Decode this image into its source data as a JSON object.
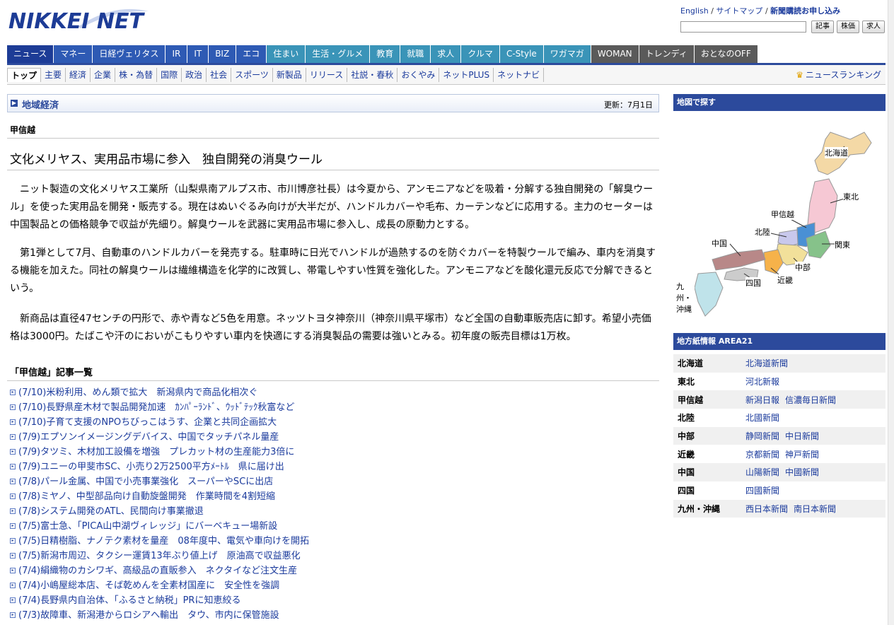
{
  "header": {
    "logo": "NIKKEI NET",
    "links": [
      "English",
      "サイトマップ",
      "新聞購読お申し込み"
    ],
    "search_placeholder": "",
    "search_buttons": [
      "記事",
      "株価",
      "求人"
    ]
  },
  "main_nav": [
    {
      "label": "ニュース",
      "color": "#1d3c96"
    },
    {
      "label": "マネー",
      "color": "#2e5ab4"
    },
    {
      "label": "日経ヴェリタス",
      "color": "#2e5ab4"
    },
    {
      "label": "IR",
      "color": "#2e5ab4"
    },
    {
      "label": "IT",
      "color": "#2e5ab4"
    },
    {
      "label": "BIZ",
      "color": "#2e5ab4"
    },
    {
      "label": "エコ",
      "color": "#2e5ab4"
    },
    {
      "label": "住まい",
      "color": "#3a94b8"
    },
    {
      "label": "生活・グルメ",
      "color": "#3a94b8"
    },
    {
      "label": "教育",
      "color": "#3a94b8"
    },
    {
      "label": "就職",
      "color": "#3a94b8"
    },
    {
      "label": "求人",
      "color": "#3a94b8"
    },
    {
      "label": "クルマ",
      "color": "#3a94b8"
    },
    {
      "label": "C-Style",
      "color": "#3a94b8"
    },
    {
      "label": "ワガマガ",
      "color": "#3a94b8"
    },
    {
      "label": "WOMAN",
      "color": "#5a5a5a"
    },
    {
      "label": "トレンディ",
      "color": "#5a5a5a"
    },
    {
      "label": "おとなのOFF",
      "color": "#5a5a5a"
    }
  ],
  "sub_nav": [
    "トップ",
    "主要",
    "経済",
    "企業",
    "株・為替",
    "国際",
    "政治",
    "社会",
    "スポーツ",
    "新製品",
    "リリース",
    "社説・春秋",
    "おくやみ",
    "ネットPLUS",
    "ネットナビ"
  ],
  "ranking_link": "ニュースランキング",
  "section": {
    "title": "地域経済",
    "updated": "更新：7月1日"
  },
  "region_label": "甲信越",
  "article": {
    "headline": "文化メリヤス、実用品市場に参入　独自開発の消臭ウール",
    "paragraphs": [
      "ニット製造の文化メリヤス工業所（山梨県南アルプス市、市川博彦社長）は今夏から、アンモニアなどを吸着・分解する独自開発の「解臭ウール」を使った実用品を開発・販売する。現在はぬいぐるみ向けが大半だが、ハンドルカバーや毛布、カーテンなどに応用する。主力のセーターは中国製品との価格競争で収益が先細り。解臭ウールを武器に実用品市場に参入し、成長の原動力とする。",
      "第1弾として7月、自動車のハンドルカバーを発売する。駐車時に日光でハンドルが過熱するのを防ぐカバーを特製ウールで編み、車内を消臭する機能を加えた。同社の解臭ウールは繊維構造を化学的に改質し、帯電しやすい性質を強化した。アンモニアなどを酸化還元反応で分解できるという。",
      "新商品は直径47センチの円形で、赤や青など5色を用意。ネッツトヨタ神奈川（神奈川県平塚市）など全国の自動車販売店に卸す。希望小売価格は3000円。たばこや汗のにおいがこもりやすい車内を快適にする消臭製品の需要は強いとみる。初年度の販売目標は1万枚。"
    ]
  },
  "list_title": "「甲信越」記事一覧",
  "articles": [
    "(7/10)米粉利用、めん類で拡大　新潟県内で商品化相次ぐ",
    "(7/10)長野県産木材で製品開発加速　ｶﾝﾊﾟｰﾗﾝﾄﾞ、ｳｯﾄﾞﾃｯｸ秋富など",
    "(7/10)子育て支援のNPOちびっこはうす、企業と共同企画拡大",
    "(7/9)エプソンイメージングデバイス、中国でタッチパネル量産",
    "(7/9)タツミ、木材加工設備を増強　プレカット材の生産能力3倍に",
    "(7/9)ユニーの甲斐市SC、小売り2万2500平方ﾒｰﾄﾙ　県に届け出",
    "(7/8)パール金属、中国で小売事業強化　スーパーやSCに出店",
    "(7/8)ミヤノ、中型部品向け自動旋盤開発　作業時間を4割短縮",
    "(7/8)システム開発のATL、民間向け事業撤退",
    "(7/5)富士急、「PICA山中湖ヴィレッジ」にバーベキュー場新設",
    "(7/5)日精樹脂、ナノテク素材を量産　08年度中、電気や車向けを開拓",
    "(7/5)新潟市周辺、タクシー運賃13年ぶり値上げ　原油高で収益悪化",
    "(7/4)絹織物のカシワギ、高級品の直販参入　ネクタイなど注文生産",
    "(7/4)小嶋屋総本店、そば乾めんを全素材国産に　安全性を強調",
    "(7/4)長野県内自治体、「ふるさと納税」PRに知恵絞る",
    "(7/3)故障車、新潟港からロシアへ輸出　タウ、市内に保管施設"
  ],
  "sidebar": {
    "map_title": "地図で探す",
    "map_labels": [
      "北海道",
      "東北",
      "甲信越",
      "北陸",
      "関東",
      "中国",
      "中部",
      "四国",
      "近畿",
      "九州・沖縄"
    ],
    "area_title": "地方紙情報 AREA21",
    "areas": [
      {
        "region": "北海道",
        "papers": [
          "北海道新聞"
        ]
      },
      {
        "region": "東北",
        "papers": [
          "河北新報"
        ]
      },
      {
        "region": "甲信越",
        "papers": [
          "新潟日報",
          "信濃毎日新聞"
        ]
      },
      {
        "region": "北陸",
        "papers": [
          "北國新聞"
        ]
      },
      {
        "region": "中部",
        "papers": [
          "静岡新聞",
          "中日新聞"
        ]
      },
      {
        "region": "近畿",
        "papers": [
          "京都新聞",
          "神戸新聞"
        ]
      },
      {
        "region": "中国",
        "papers": [
          "山陽新聞",
          "中國新聞"
        ]
      },
      {
        "region": "四国",
        "papers": [
          "四國新聞"
        ]
      },
      {
        "region": "九州・沖縄",
        "papers": [
          "西日本新聞",
          "南日本新聞"
        ]
      }
    ]
  },
  "colors": {
    "brand": "#1d3c96",
    "link": "#1a3a9c"
  }
}
